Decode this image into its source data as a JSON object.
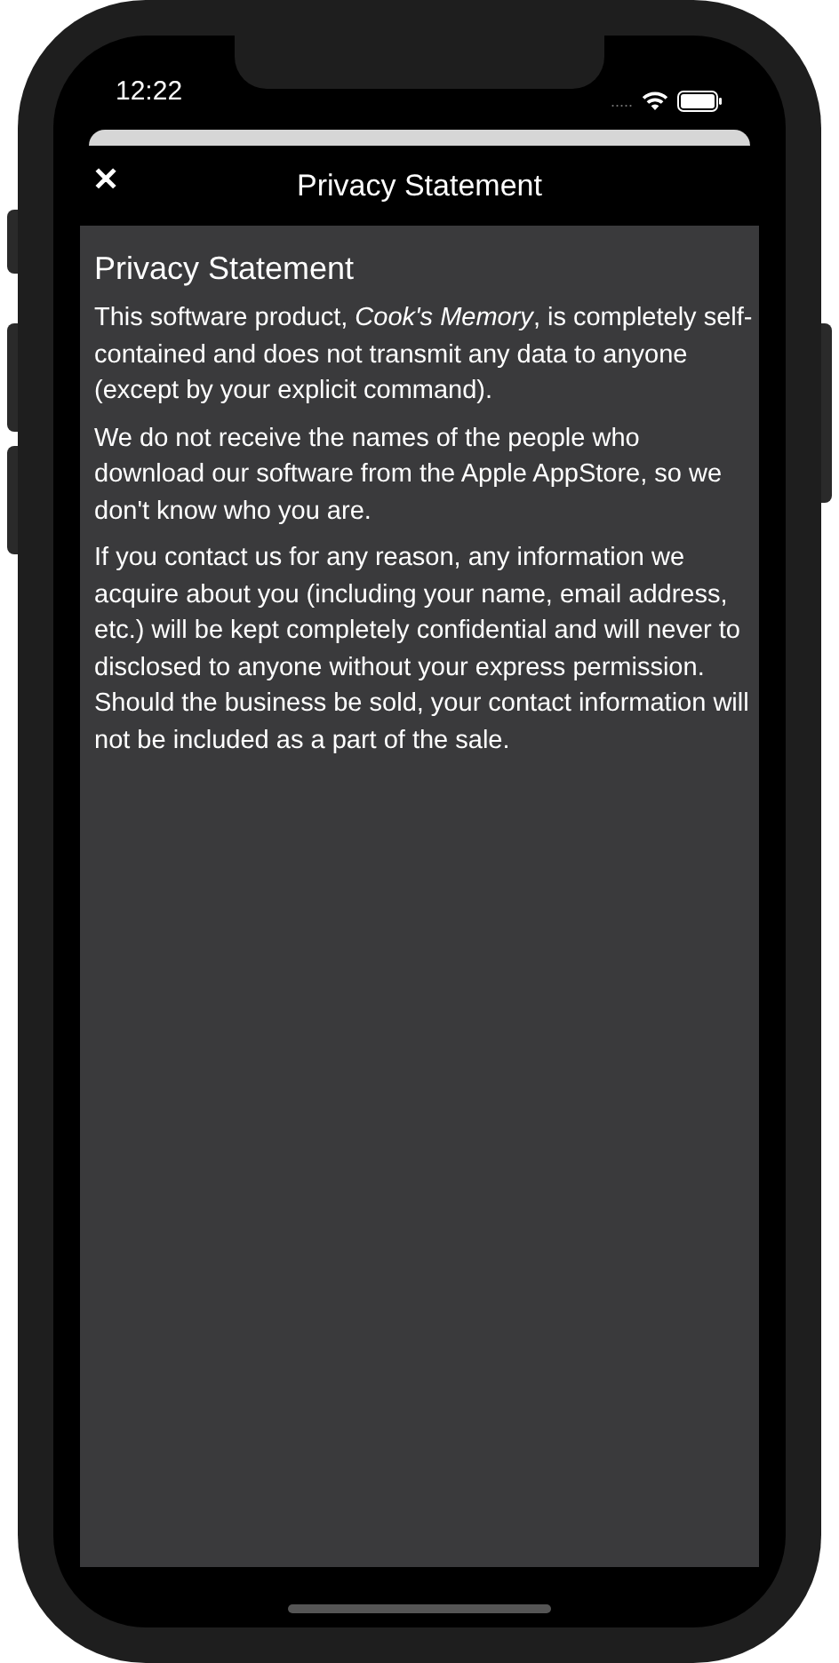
{
  "status_bar": {
    "time": "12:22",
    "signal_dots": "....."
  },
  "nav_bar": {
    "close_icon": "✕",
    "title": "Privacy Statement"
  },
  "content": {
    "heading": "Privacy Statement",
    "paragraphs": [
      "This software product, *Cook's Memory*, is completely self-contained and does not transmit any data to anyone (except by your explicit command).",
      "We do not receive the names of the people who download our software from the Apple AppStore, so we don't know who you are.",
      "If you contact us for any reason, any information we acquire about you (including your name, email address, etc.) will be kept completely confidential and will never to disclosed to anyone without your express permission. Should the business be sold, your contact information will not be included as a part of the sale."
    ]
  }
}
